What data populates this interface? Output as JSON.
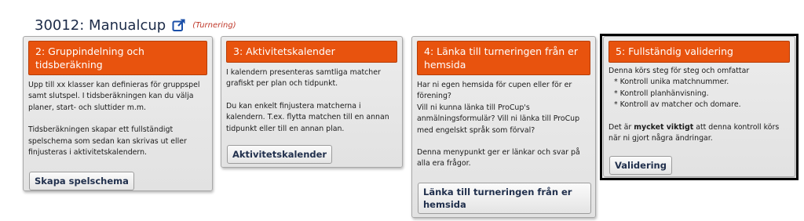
{
  "page": {
    "title": "30012: Manualcup",
    "subtitle": "(Turnering)",
    "external_link_icon": "external-link-icon"
  },
  "cards": [
    {
      "header": "2: Gruppindelning och tidsberäkning",
      "paragraphs": [
        "Upp till xx klasser kan definieras för gruppspel samt slutspel. I tidsberäkningen kan du välja planer, start- och sluttider m.m.",
        "Tidsberäkningen skapar ett fullständigt spelschema som sedan kan skrivas ut eller finjusteras i aktivitetskalendern."
      ],
      "button": "Skapa spelschema"
    },
    {
      "header": "3: Aktivitetskalender",
      "paragraphs": [
        "I kalendern presenteras samtliga matcher grafiskt per plan och tidpunkt.",
        "Du kan enkelt finjustera matcherna i kalendern. T.ex. flytta matchen till en annan tidpunkt eller till en annan plan."
      ],
      "button": "Aktivitetskalender"
    },
    {
      "header": "4: Länka till turneringen från er hemsida",
      "paragraphs": [
        "Har ni egen hemsida för cupen eller för er förening?",
        "Vill ni kunna länka till ProCup's anmälningsformulär? Vill ni länka till ProCup med engelskt språk som förval?",
        "Denna menypunkt ger er länkar och svar på alla era frågor."
      ],
      "button": "Länka till turneringen från er hemsida"
    },
    {
      "header": "5: Fullständig validering",
      "intro": "Denna körs steg för steg och omfattar",
      "bullets": [
        "* Kontroll unika matchnummer.",
        "* Kontroll planhänvisning.",
        "* Kontroll av matcher och domare."
      ],
      "note_pre": "Det är",
      "note_bold": "mycket viktigt",
      "note_post": "att denna kontroll körs när ni gjort några ändringar.",
      "button": "Validering"
    }
  ],
  "colors": {
    "header_orange": "#e8530e",
    "title_navy": "#1c2b48",
    "subtitle_red": "#c0392b",
    "selection_frame": "#000000"
  }
}
